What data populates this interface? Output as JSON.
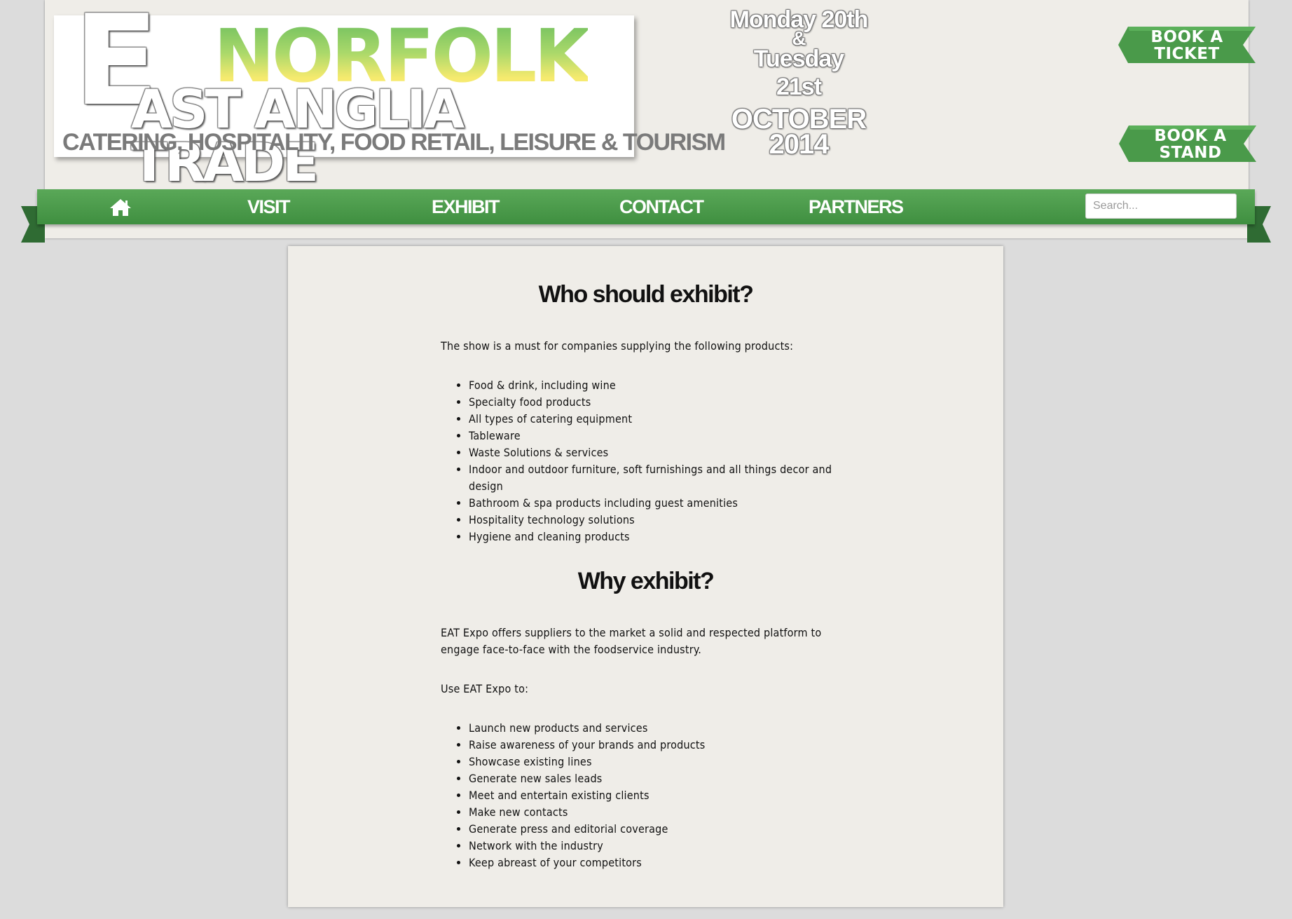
{
  "logo": {
    "e": "E",
    "norfolk": "NORFOLK",
    "main": "AST ANGLIA TRADE",
    "tagline": "CATERING, HOSPITALITY, FOOD RETAIL, LEISURE & TOURISM"
  },
  "dates": {
    "day1": "Monday 20th",
    "amp": "&",
    "day2": "Tuesday 21st",
    "month": "OCTOBER",
    "year": "2014"
  },
  "book_ticket": {
    "line1": "BOOK A",
    "line2": "TICKET"
  },
  "book_stand": {
    "line1": "BOOK A",
    "line2": "STAND"
  },
  "nav": {
    "home_icon": "home-icon",
    "items": [
      {
        "label": "VISIT"
      },
      {
        "label": "EXHIBIT"
      },
      {
        "label": "CONTACT"
      },
      {
        "label": "PARTNERS"
      }
    ]
  },
  "search": {
    "placeholder": "Search..."
  },
  "colors": {
    "nav_green": "#4a9a4a",
    "ribbon_dark": "#2f6b33",
    "page_bg": "#dcdcdc",
    "panel_bg": "#efede8"
  },
  "content": {
    "who_title": "Who should exhibit?",
    "who_intro": "The show is a must for companies supplying the following products:",
    "who_items": [
      "Food & drink, including wine",
      "Specialty food products",
      "All types of catering equipment",
      "Tableware",
      "Waste Solutions & services",
      "Indoor and outdoor furniture, soft furnishings and all things decor and design",
      "Bathroom & spa products including guest amenities",
      "Hospitality technology solutions",
      "Hygiene and cleaning products"
    ],
    "why_title": "Why exhibit?",
    "why_text": "EAT Expo offers suppliers to the market a solid and respected platform to engage face-to-face with the foodservice industry.",
    "use_text": "Use EAT Expo to:",
    "use_items": [
      "Launch new products and services",
      "Raise awareness of your brands and products",
      "Showcase existing lines",
      "Generate new sales leads",
      "Meet and entertain existing clients",
      "Make new contacts",
      "Generate press and editorial coverage",
      "Network with the industry",
      "Keep abreast of your competitors"
    ]
  }
}
